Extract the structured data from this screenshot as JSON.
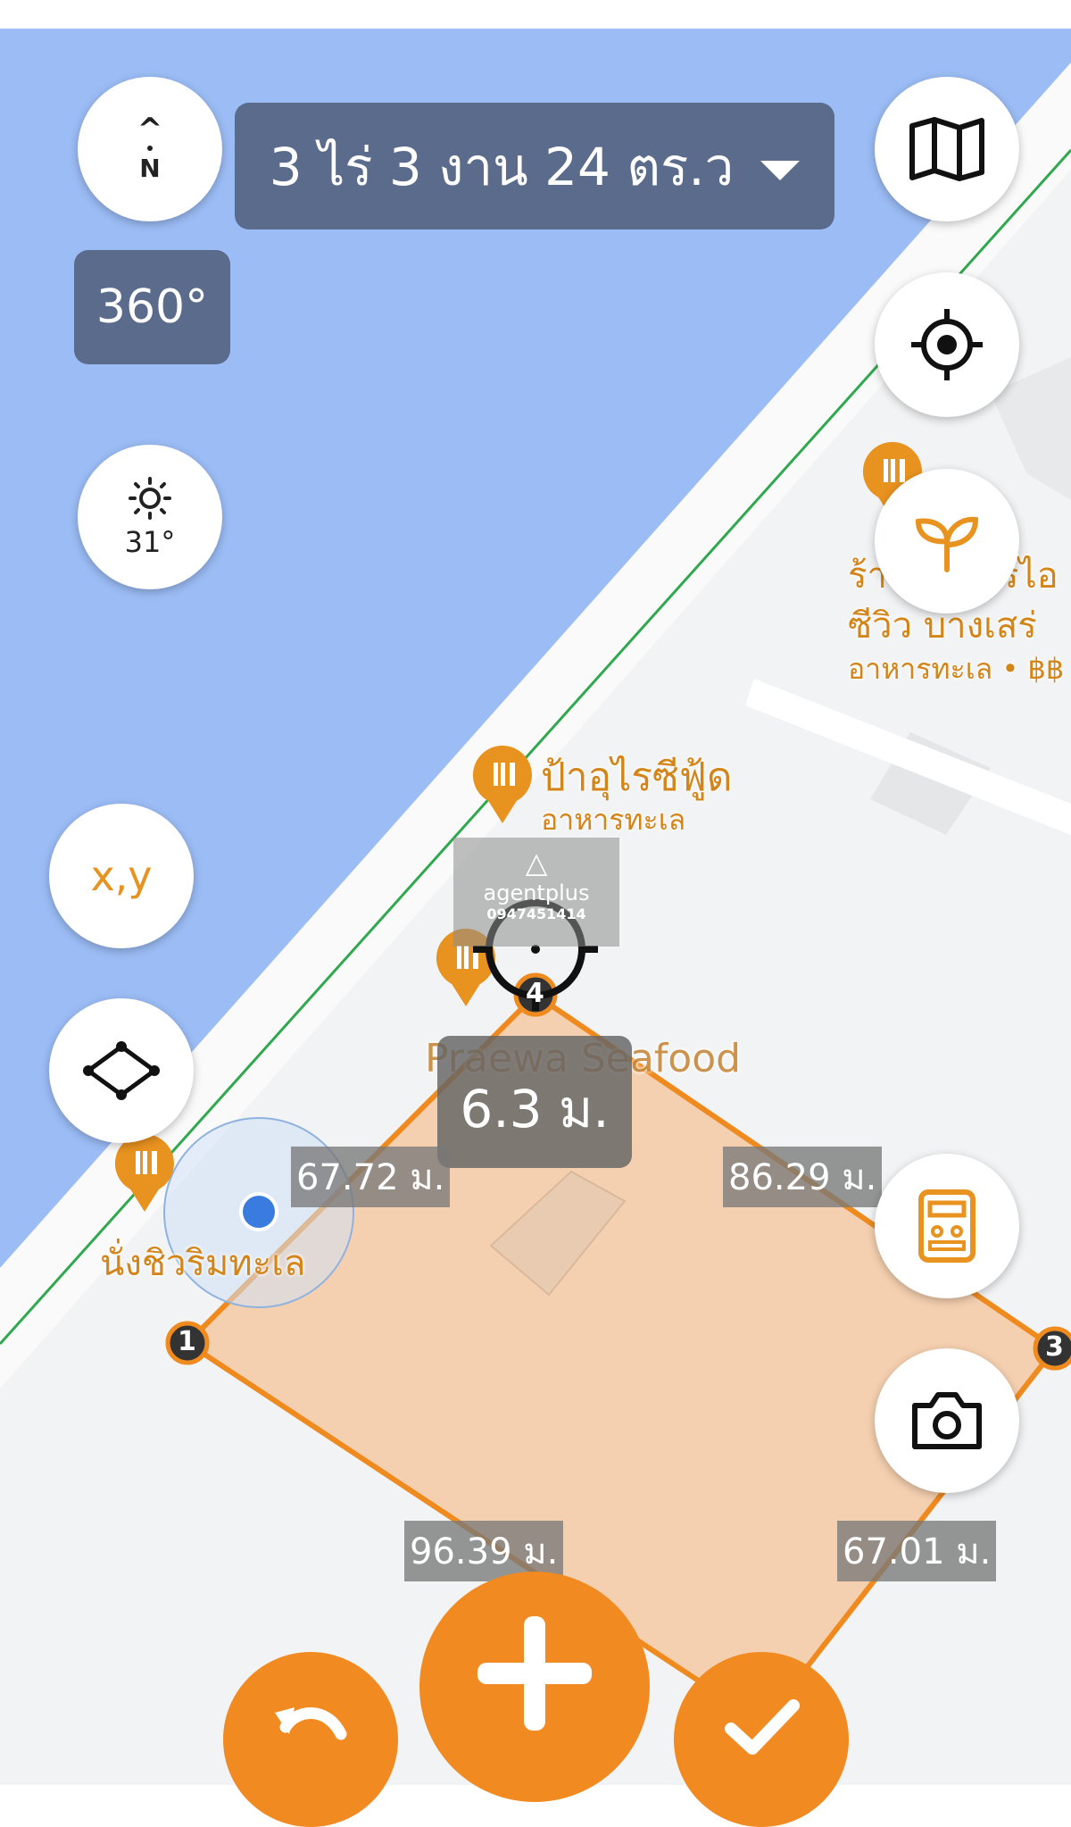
{
  "colors": {
    "sea": "#9bbcf5",
    "land": "#f2f3f4",
    "accent": "#f28a22",
    "polygon_fill": "#f6c9a3",
    "polygon_stroke": "#ef8a1f",
    "shoreline": "#2fa84f",
    "poi": "#e8921f",
    "pill": "#5a6b8c",
    "location_dot": "#3a7be0"
  },
  "header": {
    "area_text": "3 ไร่ 3 งาน 24 ตร.ว",
    "bearing_text": "360°"
  },
  "compass": {
    "letter": "N",
    "arrow": "^"
  },
  "weather": {
    "temperature": "31°",
    "icon": "sun-icon"
  },
  "left_tools": {
    "xy_label": "x,y",
    "shape_icon": "polygon-icon"
  },
  "right_tools": [
    "map-icon",
    "crosshair-target-icon",
    "leaf-icon",
    "calculator-icon",
    "camera-icon"
  ],
  "pois": [
    {
      "name": "ป้าอุไรซีฟู้ด",
      "category": "อาหารทะเล"
    },
    {
      "name": "Praewa Seafood",
      "category": ""
    },
    {
      "name": "นั่งชิวริมทะเล",
      "category": ""
    },
    {
      "name_line1": "ร้า",
      "name_line1_end": "รไอ",
      "name_line2": "ซีวิว บางเสร่",
      "category": "อาหารทะเล • ฿฿"
    }
  ],
  "watermark": {
    "brand": "agentplus",
    "phone": "0947451414"
  },
  "measurement": {
    "live_distance": "6.3 ม.",
    "edges": [
      "67.72 ม.",
      "86.29 ม.",
      "96.39 ม.",
      "67.01 ม."
    ],
    "vertices": [
      "1",
      "3",
      "4"
    ]
  },
  "bottom_actions": [
    "undo-icon",
    "plus-icon",
    "check-icon"
  ]
}
